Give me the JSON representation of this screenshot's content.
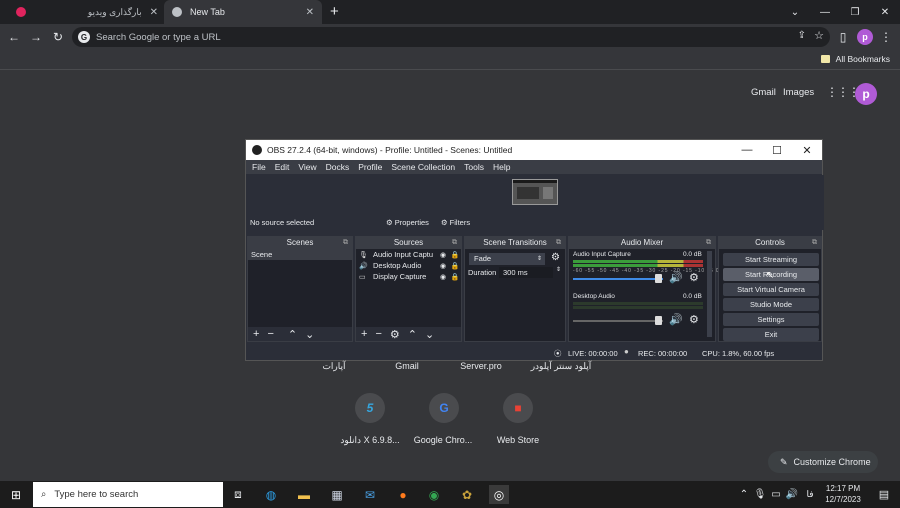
{
  "tabs": [
    {
      "title": "بارگذاری ویدیو",
      "active": false
    },
    {
      "title": "New Tab",
      "active": true
    }
  ],
  "new_tab_label": "+",
  "toolbar": {
    "omnibox_placeholder": "Search Google or type a URL"
  },
  "bookmarks": {
    "all_label": "All Bookmarks"
  },
  "ntp": {
    "gmail": "Gmail",
    "images": "Images",
    "avatar": "p"
  },
  "obs": {
    "title": "OBS 27.2.4 (64-bit, windows) - Profile: Untitled - Scenes: Untitled",
    "menu": [
      "File",
      "Edit",
      "View",
      "Docks",
      "Profile",
      "Scene Collection",
      "Tools",
      "Help"
    ],
    "no_source": "No source selected",
    "properties": "Properties",
    "filters": "Filters",
    "docks": {
      "scenes": "Scenes",
      "sources": "Sources",
      "transitions": "Scene Transitions",
      "mixer": "Audio Mixer",
      "controls": "Controls"
    },
    "scenes": [
      "Scene"
    ],
    "sources": [
      "Audio Input Captu",
      "Desktop Audio",
      "Display Capture"
    ],
    "transition": {
      "type": "Fade",
      "duration_label": "Duration",
      "duration": "300 ms"
    },
    "mixer": [
      {
        "name": "Audio Input Capture",
        "db": "0.0 dB"
      },
      {
        "name": "Desktop Audio",
        "db": "0.0 dB"
      }
    ],
    "meter_ticks": "-60 -55 -50 -45 -40 -35 -30 -25 -20 -15 -10 -5 0",
    "controls": [
      "Start Streaming",
      "Start Recording",
      "Start Virtual Camera",
      "Studio Mode",
      "Settings",
      "Exit"
    ],
    "status": {
      "live": "LIVE: 00:00:00",
      "rec": "REC: 00:00:00",
      "cpu": "CPU: 1.8%, 60.00 fps"
    }
  },
  "shortcuts_row1": [
    "آپارات",
    "Gmail",
    "Server.pro",
    "آپلود سنتر آپلودر"
  ],
  "shortcuts_row2": [
    {
      "label": "دانلود X 6.9.8...",
      "icon": "5"
    },
    {
      "label": "Google Chro...",
      "icon": "G"
    },
    {
      "label": "Web Store",
      "icon": "■"
    }
  ],
  "customize": "Customize Chrome",
  "taskbar": {
    "search": "Type here to search",
    "lang": "فا",
    "time": "12:17 PM",
    "date": "12/7/2023"
  }
}
